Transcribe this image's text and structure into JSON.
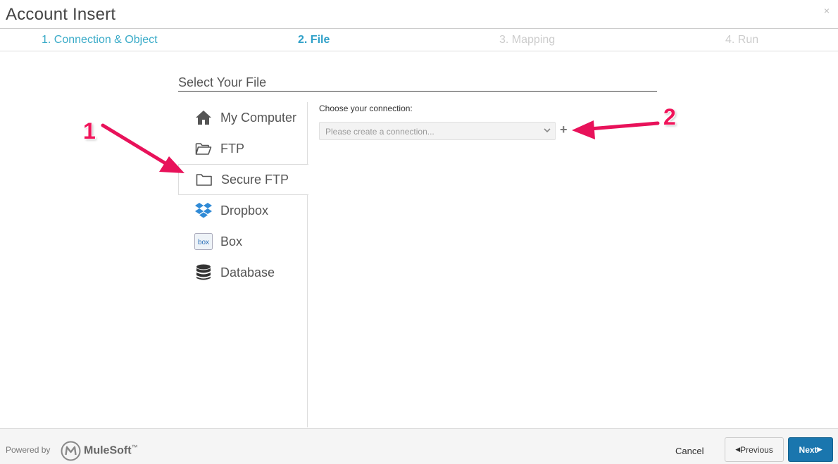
{
  "window": {
    "title": "Account Insert",
    "close_glyph": "×"
  },
  "steps": [
    {
      "label": "1. Connection & Object"
    },
    {
      "label": "2. File"
    },
    {
      "label": "3. Mapping"
    },
    {
      "label": "4. Run"
    }
  ],
  "section_title": "Select Your File",
  "sources": [
    {
      "label": "My Computer",
      "icon": "home-icon"
    },
    {
      "label": "FTP",
      "icon": "folder-open-icon"
    },
    {
      "label": "Secure FTP",
      "icon": "folder-icon"
    },
    {
      "label": "Dropbox",
      "icon": "dropbox-icon"
    },
    {
      "label": "Box",
      "icon": "box-icon"
    },
    {
      "label": "Database",
      "icon": "database-icon"
    }
  ],
  "connection": {
    "label": "Choose your connection:",
    "selected": "Please create a connection...",
    "add_glyph": "+"
  },
  "annotations": {
    "one": "1",
    "two": "2",
    "color": "#f0145a"
  },
  "footer": {
    "powered_by": "Powered by",
    "brand": "MuleSoft",
    "trademark": "™",
    "cancel": "Cancel",
    "previous": "Previous",
    "next": "Next"
  },
  "colors": {
    "accent": "#2fa0c8",
    "primary_button": "#1a76ae"
  }
}
